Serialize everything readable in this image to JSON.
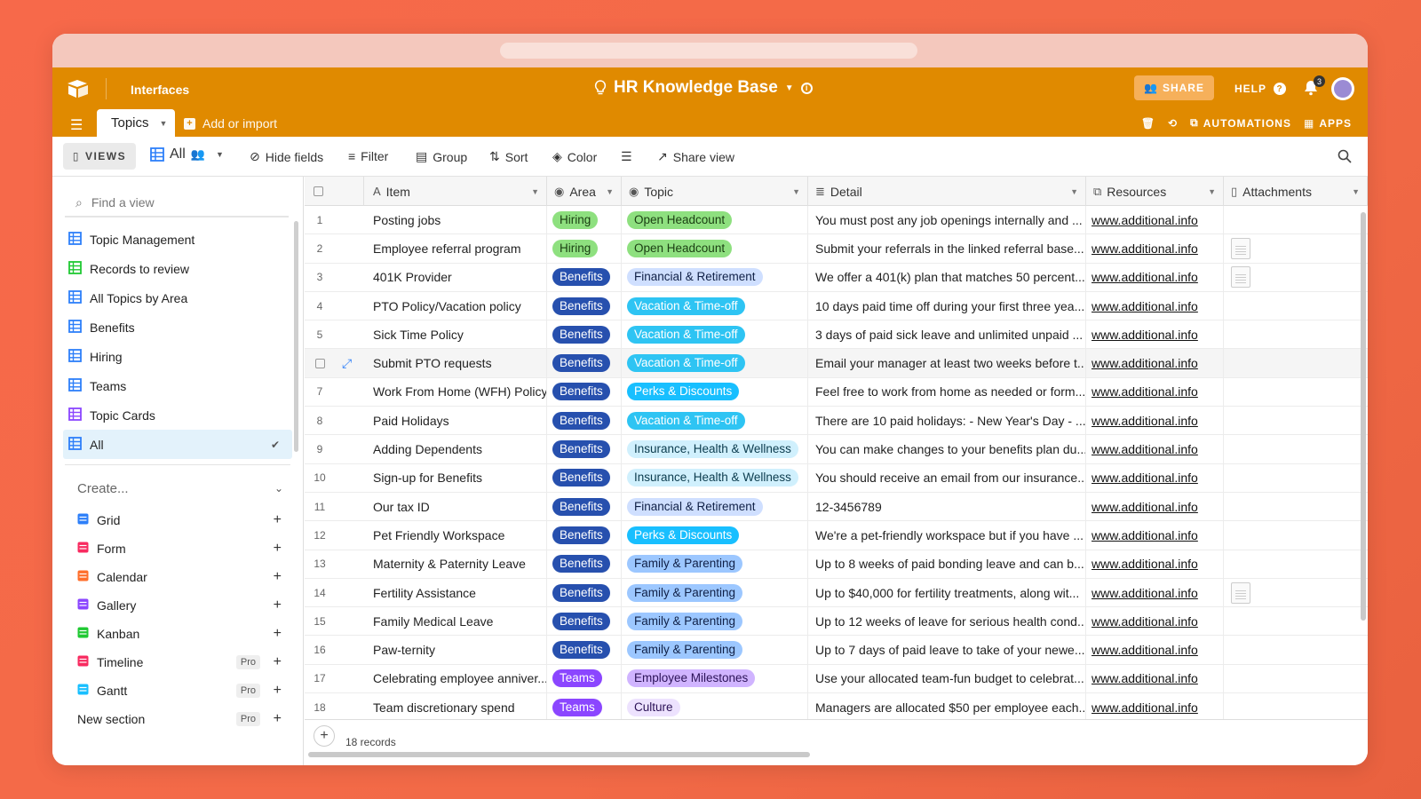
{
  "header": {
    "interfaces_label": "Interfaces",
    "base_title": "HR Knowledge Base",
    "share_label": "SHARE",
    "help_label": "HELP",
    "notification_count": "3",
    "tab_label": "Topics",
    "add_import_label": "Add or import",
    "automations_label": "AUTOMATIONS",
    "apps_label": "APPS"
  },
  "viewbar": {
    "views_label": "VIEWS",
    "current_view": "All",
    "hide_fields": "Hide fields",
    "filter": "Filter",
    "group": "Group",
    "sort": "Sort",
    "color": "Color",
    "share_view": "Share view"
  },
  "sidebar": {
    "find_placeholder": "Find a view",
    "views": [
      {
        "label": "Topic Management",
        "icon": "grid-icon",
        "color": "#2d7ff9"
      },
      {
        "label": "Records to review",
        "icon": "kanban-icon",
        "color": "#20c933"
      },
      {
        "label": "All Topics by Area",
        "icon": "grid-icon",
        "color": "#2d7ff9"
      },
      {
        "label": "Benefits",
        "icon": "grid-icon",
        "color": "#2d7ff9"
      },
      {
        "label": "Hiring",
        "icon": "grid-icon",
        "color": "#2d7ff9"
      },
      {
        "label": "Teams",
        "icon": "grid-icon",
        "color": "#2d7ff9"
      },
      {
        "label": "Topic Cards",
        "icon": "gallery-icon",
        "color": "#8b46ff"
      },
      {
        "label": "All",
        "icon": "grid-icon",
        "color": "#2d7ff9"
      }
    ],
    "create_label": "Create...",
    "create_items": [
      {
        "label": "Grid",
        "color": "#2d7ff9",
        "pro": ""
      },
      {
        "label": "Form",
        "color": "#f82b60",
        "pro": ""
      },
      {
        "label": "Calendar",
        "color": "#ff6f2c",
        "pro": ""
      },
      {
        "label": "Gallery",
        "color": "#8b46ff",
        "pro": ""
      },
      {
        "label": "Kanban",
        "color": "#20c933",
        "pro": ""
      },
      {
        "label": "Timeline",
        "color": "#f82b60",
        "pro": "Pro"
      },
      {
        "label": "Gantt",
        "color": "#18bfff",
        "pro": "Pro"
      }
    ],
    "new_section": "New section",
    "new_section_pro": "Pro"
  },
  "grid": {
    "columns": [
      "Item",
      "Area",
      "Topic",
      "Detail",
      "Resources",
      "Attachments"
    ],
    "rows": [
      {
        "num": "1",
        "item": "Posting jobs",
        "area": "Hiring",
        "topic": "Open Headcount",
        "detail": "You must post any job openings internally and ...",
        "resource": "www.additional.info",
        "attach": false
      },
      {
        "num": "2",
        "item": "Employee referral program",
        "area": "Hiring",
        "topic": "Open Headcount",
        "detail": "Submit your referrals in the linked referral base...",
        "resource": "www.additional.info",
        "attach": true
      },
      {
        "num": "3",
        "item": "401K Provider",
        "area": "Benefits",
        "topic": "Financial & Retirement",
        "detail": "We offer a 401(k) plan that matches 50 percent...",
        "resource": "www.additional.info",
        "attach": true
      },
      {
        "num": "4",
        "item": "PTO Policy/Vacation policy",
        "area": "Benefits",
        "topic": "Vacation & Time-off",
        "detail": "10 days paid time off during your first three yea...",
        "resource": "www.additional.info",
        "attach": false
      },
      {
        "num": "5",
        "item": "Sick Time Policy",
        "area": "Benefits",
        "topic": "Vacation & Time-off",
        "detail": "3 days of paid sick leave and unlimited unpaid ...",
        "resource": "www.additional.info",
        "attach": false
      },
      {
        "num": "",
        "item": "Submit PTO requests",
        "area": "Benefits",
        "topic": "Vacation & Time-off",
        "detail": "Email your manager at least two weeks before t...",
        "resource": "www.additional.info",
        "attach": false
      },
      {
        "num": "7",
        "item": "Work From Home (WFH) Policy",
        "area": "Benefits",
        "topic": "Perks & Discounts",
        "detail": "Feel free to work from home as needed or form...",
        "resource": "www.additional.info",
        "attach": false
      },
      {
        "num": "8",
        "item": "Paid Holidays",
        "area": "Benefits",
        "topic": "Vacation & Time-off",
        "detail": "There are 10 paid holidays: - New Year's Day - ...",
        "resource": "www.additional.info",
        "attach": false
      },
      {
        "num": "9",
        "item": "Adding Dependents",
        "area": "Benefits",
        "topic": "Insurance, Health & Wellness",
        "detail": "You can make changes to your benefits plan du...",
        "resource": "www.additional.info",
        "attach": false
      },
      {
        "num": "10",
        "item": "Sign-up for Benefits",
        "area": "Benefits",
        "topic": "Insurance, Health & Wellness",
        "detail": "You should receive an email from our insurance...",
        "resource": "www.additional.info",
        "attach": false
      },
      {
        "num": "11",
        "item": "Our tax ID",
        "area": "Benefits",
        "topic": "Financial & Retirement",
        "detail": "12-3456789",
        "resource": "www.additional.info",
        "attach": false
      },
      {
        "num": "12",
        "item": "Pet Friendly Workspace",
        "area": "Benefits",
        "topic": "Perks & Discounts",
        "detail": "We're a pet-friendly workspace but if you have ...",
        "resource": "www.additional.info",
        "attach": false
      },
      {
        "num": "13",
        "item": "Maternity & Paternity Leave",
        "area": "Benefits",
        "topic": "Family & Parenting",
        "detail": "Up to 8 weeks of paid bonding leave and can b...",
        "resource": "www.additional.info",
        "attach": false
      },
      {
        "num": "14",
        "item": "Fertility Assistance",
        "area": "Benefits",
        "topic": "Family & Parenting",
        "detail": "Up to $40,000 for fertility treatments, along wit...",
        "resource": "www.additional.info",
        "attach": true
      },
      {
        "num": "15",
        "item": "Family Medical Leave",
        "area": "Benefits",
        "topic": "Family & Parenting",
        "detail": "Up to 12 weeks of leave for serious health cond...",
        "resource": "www.additional.info",
        "attach": false
      },
      {
        "num": "16",
        "item": "Paw-ternity",
        "area": "Benefits",
        "topic": "Family & Parenting",
        "detail": "Up to 7 days of paid leave to take of your newe...",
        "resource": "www.additional.info",
        "attach": false
      },
      {
        "num": "17",
        "item": "Celebrating employee anniver...",
        "area": "Teams",
        "topic": "Employee Milestones",
        "detail": "Use your allocated team-fun budget to celebrat...",
        "resource": "www.additional.info",
        "attach": false
      },
      {
        "num": "18",
        "item": "Team discretionary spend",
        "area": "Teams",
        "topic": "Culture",
        "detail": "Managers are allocated $50 per employee each...",
        "resource": "www.additional.info",
        "attach": false
      }
    ],
    "records_label": "18 records"
  },
  "colors": {
    "header_orange": "#e08a00",
    "area": {
      "Hiring": [
        "#8ee07f",
        "#1a3d12"
      ],
      "Benefits": [
        "#2750ae",
        "#ffffff"
      ],
      "Teams": [
        "#8b46ff",
        "#ffffff"
      ]
    },
    "topic": {
      "Open Headcount": [
        "#8ee07f",
        "#1a3d12"
      ],
      "Financial & Retirement": [
        "#cfdfff",
        "#102046"
      ],
      "Vacation & Time-off": [
        "#2ec4f3",
        "#ffffff"
      ],
      "Perks & Discounts": [
        "#18bfff",
        "#ffffff"
      ],
      "Insurance, Health & Wellness": [
        "#d0f0fd",
        "#0b3b4d"
      ],
      "Family & Parenting": [
        "#9cc7ff",
        "#102046"
      ],
      "Employee Milestones": [
        "#d0b4ff",
        "#2b1257"
      ],
      "Culture": [
        "#ede2fe",
        "#2b1257"
      ]
    }
  }
}
